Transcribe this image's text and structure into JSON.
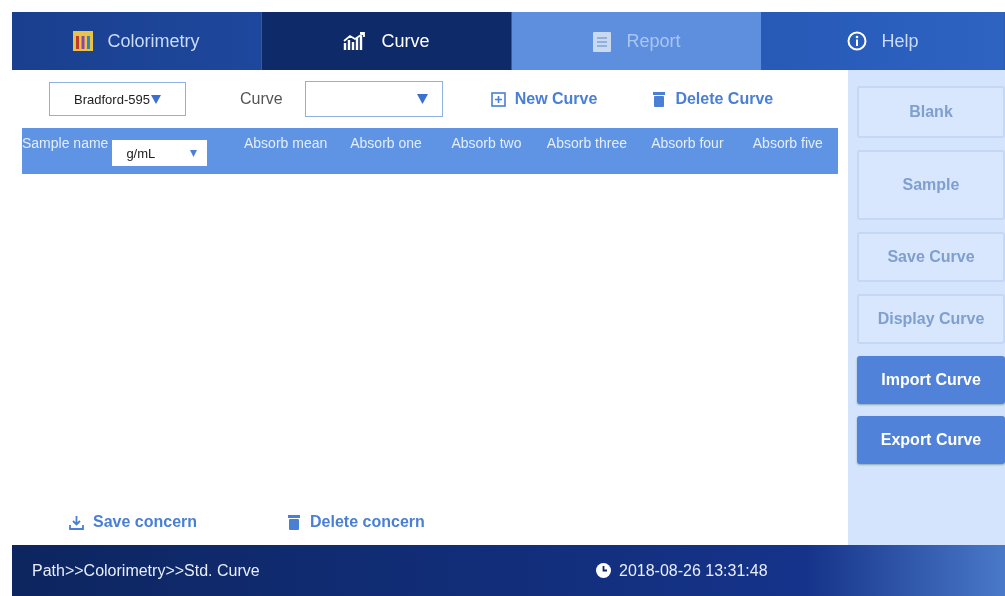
{
  "tabs": [
    {
      "label": "Colorimetry",
      "selected": false,
      "disabled": false
    },
    {
      "label": "Curve",
      "selected": true,
      "disabled": false
    },
    {
      "label": "Report",
      "selected": false,
      "disabled": true
    },
    {
      "label": "Help",
      "selected": false,
      "disabled": false
    }
  ],
  "toolbar": {
    "method": "Bradford-595",
    "curve_label": "Curve",
    "new_curve": "New Curve",
    "delete_curve": "Delete Curve"
  },
  "table": {
    "first_column": "Sample name",
    "unit": "g/mL",
    "columns": [
      "Absorb mean",
      "Absorb one",
      "Absorb two",
      "Absorb three",
      "Absorb four",
      "Absorb five"
    ]
  },
  "actions": {
    "save": "Save concern",
    "delete": "Delete concern"
  },
  "side_buttons": [
    {
      "label": "Blank",
      "disabled": true
    },
    {
      "label": "Sample",
      "disabled": true
    },
    {
      "label": "Save Curve",
      "disabled": true
    },
    {
      "label": "Display Curve",
      "disabled": true
    },
    {
      "label": "Import Curve",
      "disabled": false
    },
    {
      "label": "Export Curve",
      "disabled": false
    }
  ],
  "status_bar": {
    "path": "Path>>Colorimetry>>Std. Curve",
    "time": "2018-08-26 13:31:48"
  }
}
